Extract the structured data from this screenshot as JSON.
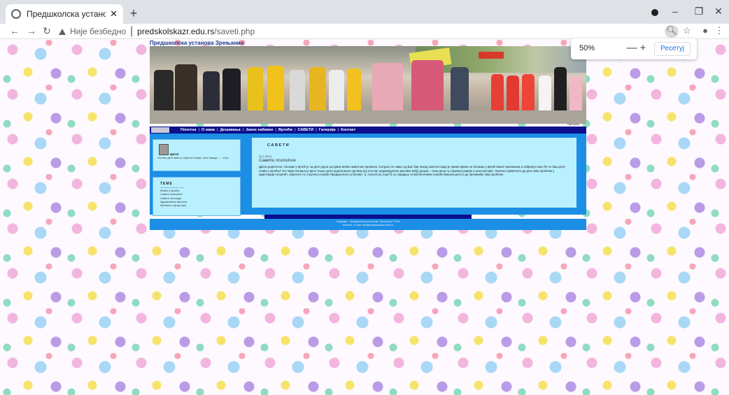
{
  "browser": {
    "tab_title": "Предшколска установа Зрењан",
    "tab_close": "✕",
    "new_tab": "+",
    "controls": {
      "minimize": "–",
      "maximize": "❐",
      "close": "✕"
    },
    "nav": {
      "back": "←",
      "forward": "→",
      "reload": "↻"
    },
    "security_label": "Није безбедно",
    "url_domain": "predskolskazr.edu.rs",
    "url_path": "/saveti.php",
    "icons": [
      "zoom-icon",
      "star-icon",
      "account-icon",
      "menu-icon"
    ],
    "zoom_popup": {
      "percent": "50%",
      "minus": "—",
      "plus": "+",
      "reset": "Ресетуј"
    }
  },
  "site": {
    "title": "Предшколска установа Зрењанин",
    "search_label": "Претрага",
    "nav_links": [
      "Почетна",
      "О нама",
      "Дешавања",
      "Јавне набавке",
      "Вртићи",
      "САВЕТИ",
      "Галерија",
      "Контакт"
    ],
    "quote": {
      "heading": "Цитат",
      "text": "Уколико дете живи уз најбоље ствари, нико никада... — Русо"
    },
    "themes": {
      "heading": "ТЕМЕ",
      "items": [
        "Живот у вртићу",
        "Савети психолога",
        "Савети логопеда",
        "Здравствена заштита",
        "Кретање и дечје игре"
      ]
    },
    "article": {
      "heading": "САВЕТИ",
      "date": "12.1.2015.",
      "subheading": "Савети психолога",
      "text": "Драги родитељи, полазак у вртић је за дете једна од првих већих животних промена. Сигурно се свако од Вас бар некад запитао када је право време за полазак у вртић вашег малишана и забринуо како ће се баш дете снаћи у вртићу? На таква питања је врло тешко дати једнозначан одговор јер постоје индивидуалне разлике међу децом – нека деца су спремна раније а нека касније. Уколико приметите да дете има проблем у адаптацији на вртић, обратите се стручној служби Предшколске установе, тј. психологу, који ће уз сарадњу са васпитачима помоћи Вашем детету да превазиђе овај проблем."
    },
    "footer": {
      "line1": "Copyright - Предшколска установа \"Зрењанин\" 2015",
      "line2": "Контакт, е-mail: info@predskolskazr.edu.rs"
    }
  }
}
